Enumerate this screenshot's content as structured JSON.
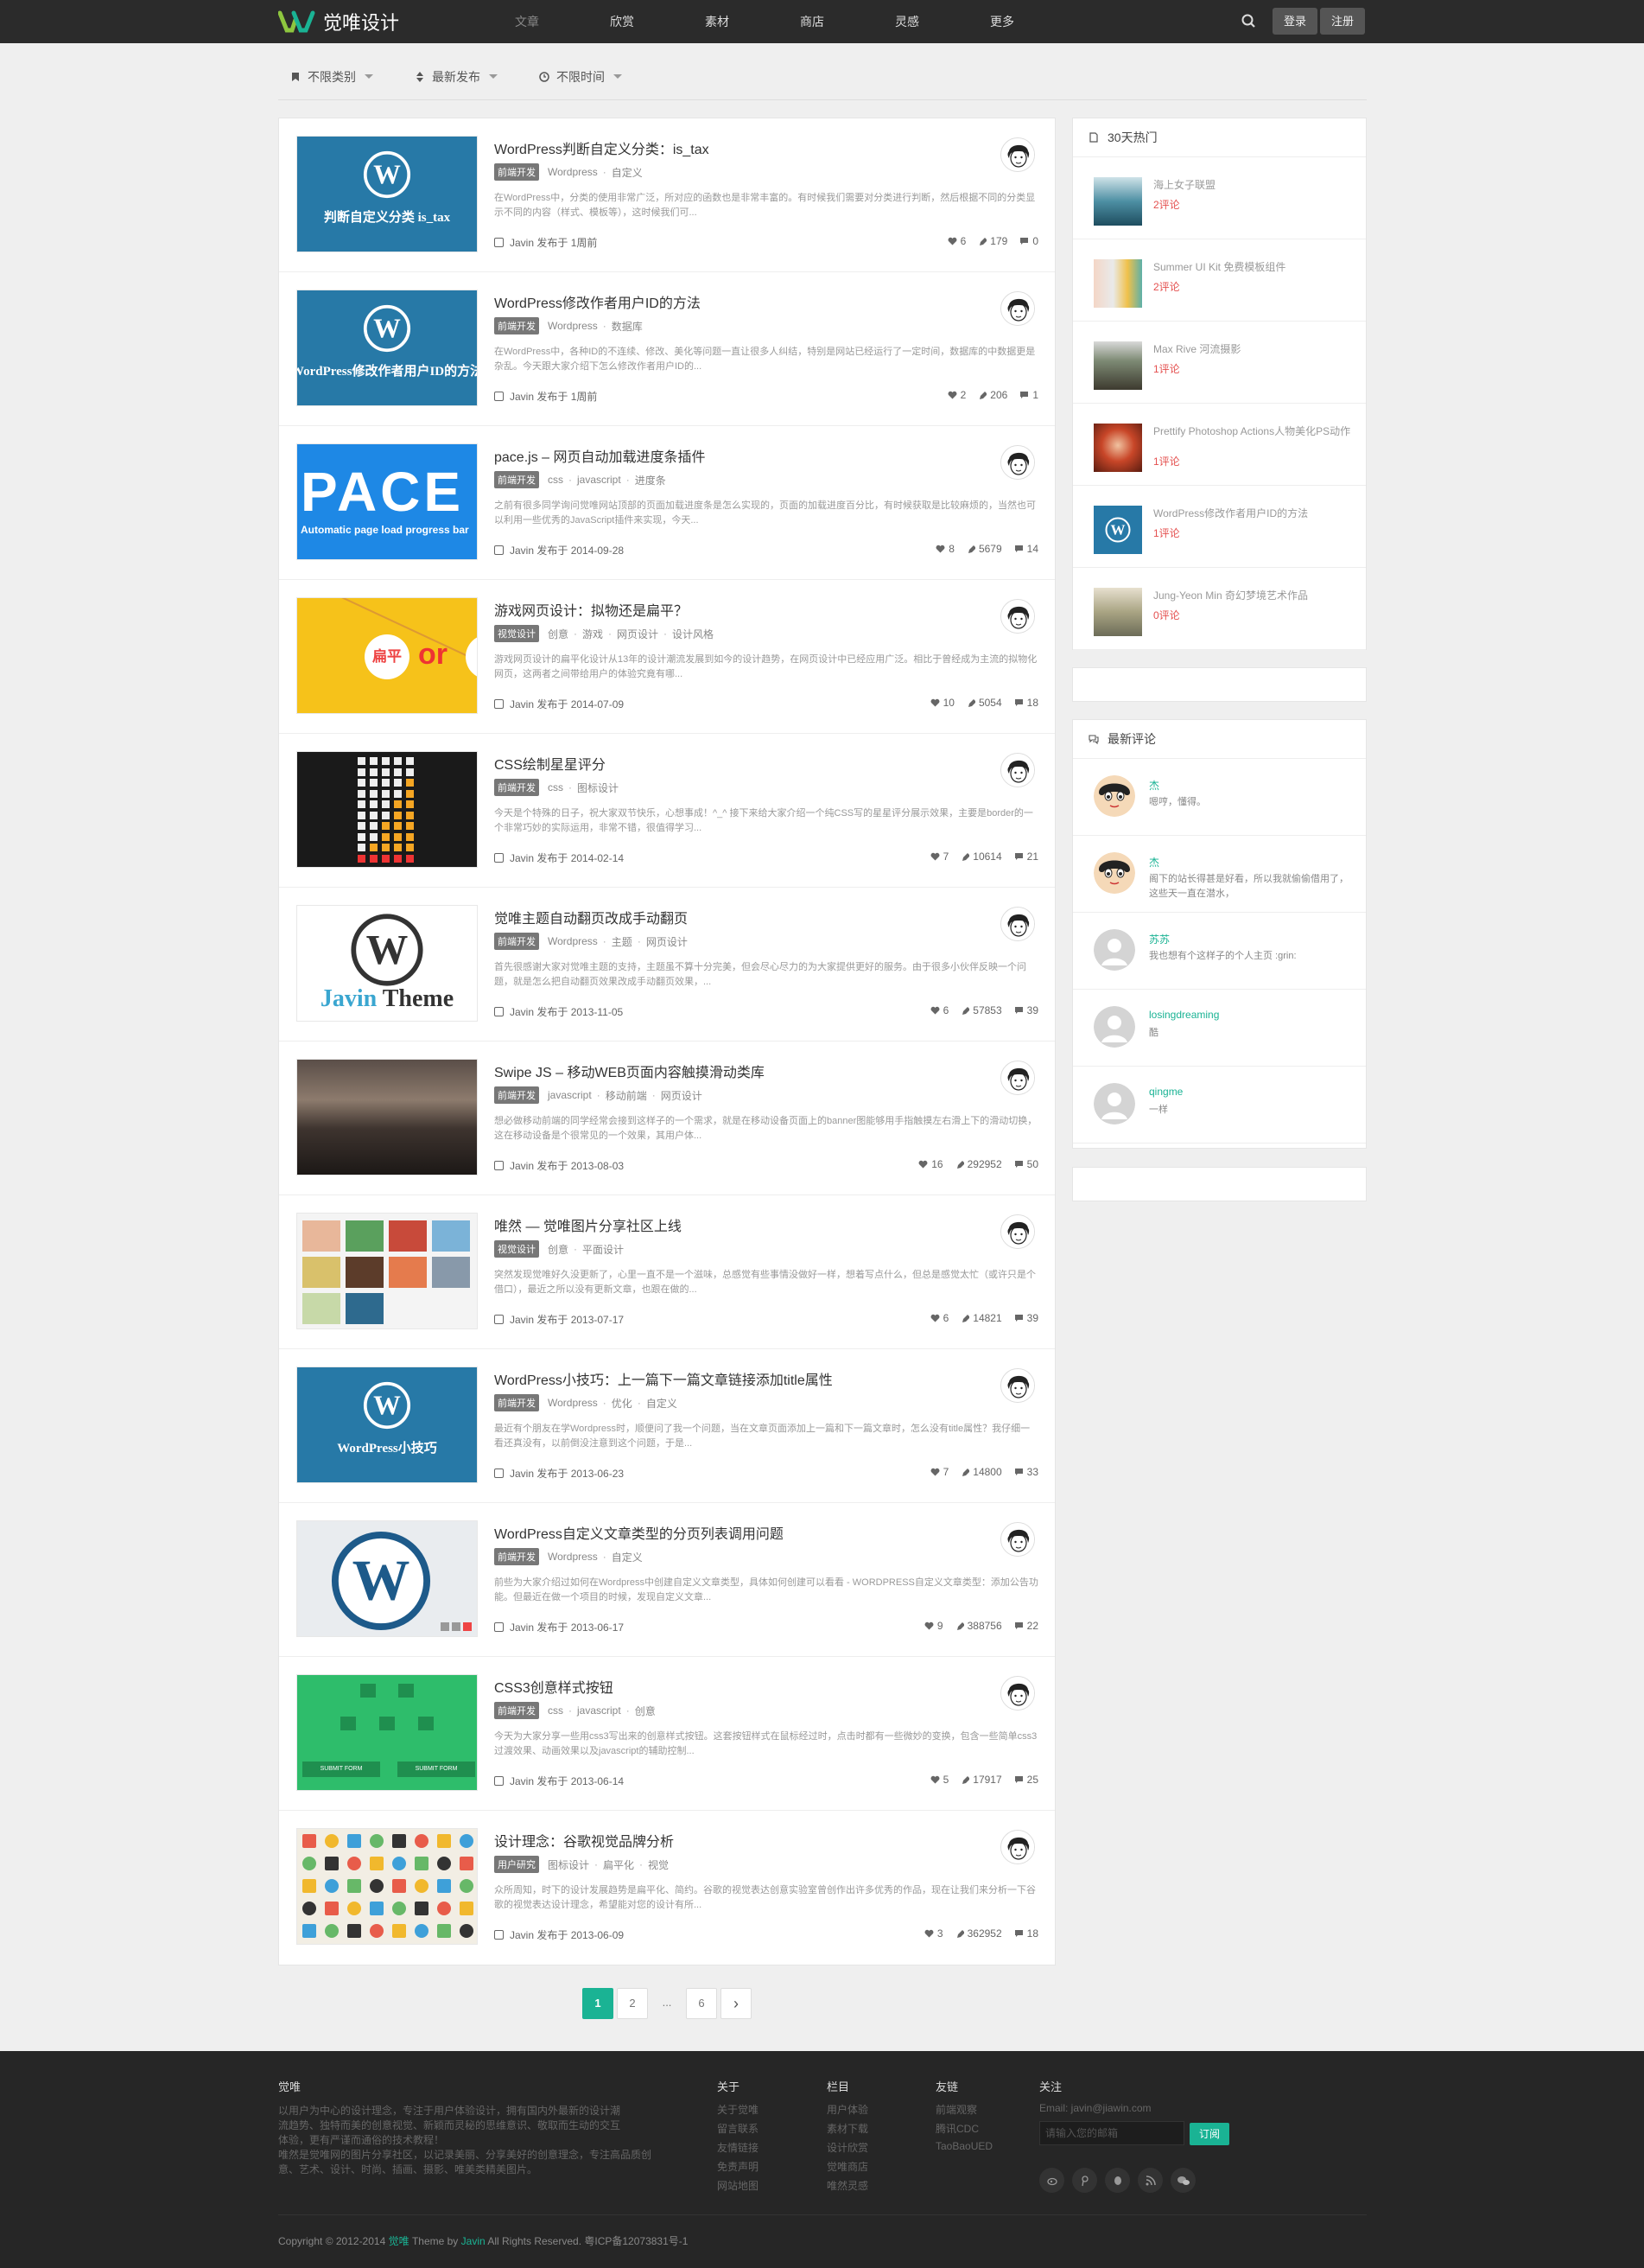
{
  "brand": {
    "name": "觉唯设计"
  },
  "nav": [
    "文章",
    "欣赏",
    "素材",
    "商店",
    "灵感",
    "更多"
  ],
  "auth": {
    "login": "登录",
    "register": "注册"
  },
  "filters": [
    "不限类别",
    "最新发布",
    "不限时间"
  ],
  "posts": [
    {
      "title": "WordPress判断自定义分类：is_tax",
      "badge": "前端开发",
      "tags": [
        "Wordpress",
        "自定义"
      ],
      "excerpt": "在WordPress中，分类的使用非常广泛，所对应的函数也是非常丰富的。有时候我们需要对分类进行判断，然后根据不同的分类显示不同的内容（样式、模板等），这时候我们可...",
      "author": "Javin",
      "date": "发布于 1周前",
      "likes": "6",
      "views": "179",
      "comments": "0",
      "thumb": "wp",
      "thumb_text": "判断自定义分类 is_tax"
    },
    {
      "title": "WordPress修改作者用户ID的方法",
      "badge": "前端开发",
      "tags": [
        "Wordpress",
        "数据库"
      ],
      "excerpt": "在WordPress中，各种ID的不连续、修改、美化等问题一直让很多人纠结，特别是网站已经运行了一定时间，数据库的中数据更是杂乱。今天跟大家介绍下怎么修改作者用户ID的...",
      "author": "Javin",
      "date": "发布于 1周前",
      "likes": "2",
      "views": "206",
      "comments": "1",
      "thumb": "wp",
      "thumb_text": "WordPress修改作者用户ID的方法"
    },
    {
      "title": "pace.js – 网页自动加载进度条插件",
      "badge": "前端开发",
      "tags": [
        "css",
        "javascript",
        "进度条"
      ],
      "excerpt": "之前有很多同学询问觉唯网站顶部的页面加载进度条是怎么实现的，页面的加载进度百分比，有时候获取是比较麻烦的，当然也可以利用一些优秀的JavaScript插件来实现，今天...",
      "author": "Javin",
      "date": "发布于 2014-09-28",
      "likes": "8",
      "views": "5679",
      "comments": "14",
      "thumb": "pace",
      "thumb_text": "PACE",
      "thumb_sub": "Automatic page load progress bar"
    },
    {
      "title": "游戏网页设计：拟物还是扁平？",
      "badge": "视觉设计",
      "tags": [
        "创意",
        "游戏",
        "网页设计",
        "设计风格"
      ],
      "excerpt": "游戏网页设计的扁平化设计从13年的设计潮流发展到如今的设计趋势，在网页设计中已经应用广泛。相比于曾经成为主流的拟物化网页，这两者之间带给用户的体验究竟有哪...",
      "author": "Javin",
      "date": "发布于 2014-07-09",
      "likes": "10",
      "views": "5054",
      "comments": "18",
      "thumb": "game",
      "thumb_text": "扁平",
      "thumb_or": "or"
    },
    {
      "title": "CSS绘制星星评分",
      "badge": "前端开发",
      "tags": [
        "css",
        "图标设计"
      ],
      "excerpt": "今天是个特殊的日子，祝大家双节快乐，心想事成！^_^ 接下来给大家介绍一个纯CSS写的星星评分展示效果，主要是border的一个非常巧妙的实际运用，非常不错，很值得学习...",
      "author": "Javin",
      "date": "发布于 2014-02-14",
      "likes": "7",
      "views": "10614",
      "comments": "21",
      "thumb": "stars"
    },
    {
      "title": "觉唯主题自动翻页改成手动翻页",
      "badge": "前端开发",
      "tags": [
        "Wordpress",
        "主题",
        "网页设计"
      ],
      "excerpt": "首先很感谢大家对觉唯主题的支持，主题虽不算十分完美，但会尽心尽力的为大家提供更好的服务。由于很多小伙伴反映一个问题，就是怎么把自动翻页效果改成手动翻页效果，...",
      "author": "Javin",
      "date": "发布于 2013-11-05",
      "likes": "6",
      "views": "57853",
      "comments": "39",
      "thumb": "theme",
      "thumb_text": "Javin Theme"
    },
    {
      "title": "Swipe JS – 移动WEB页面内容触摸滑动类库",
      "badge": "前端开发",
      "tags": [
        "javascript",
        "移动前端",
        "网页设计"
      ],
      "excerpt": "想必做移动前端的同学经常会接到这样子的一个需求，就是在移动设备页面上的banner图能够用手指触摸左右滑上下的滑动切换，这在移动设备是个很常见的一个效果，其用户体...",
      "author": "Javin",
      "date": "发布于 2013-08-03",
      "likes": "16",
      "views": "292952",
      "comments": "50",
      "thumb": "sky"
    },
    {
      "title": "唯然 — 觉唯图片分享社区上线",
      "badge": "视觉设计",
      "tags": [
        "创意",
        "平面设计"
      ],
      "excerpt": "突然发现觉唯好久没更新了，心里一直不是一个滋味，总感觉有些事情没做好一样，想着写点什么，但总是感觉太忙（或许只是个借口），最近之所以没有更新文章，也跟在做的...",
      "author": "Javin",
      "date": "发布于 2013-07-17",
      "likes": "6",
      "views": "14821",
      "comments": "39",
      "thumb": "grid"
    },
    {
      "title": "WordPress小技巧：上一篇下一篇文章链接添加title属性",
      "badge": "前端开发",
      "tags": [
        "Wordpress",
        "优化",
        "自定义"
      ],
      "excerpt": "最近有个朋友在学Wordpress时，顺便问了我一个问题，当在文章页面添加上一篇和下一篇文章时，怎么没有title属性？我仔细一看还真没有，以前倒没注意到这个问题，于是...",
      "author": "Javin",
      "date": "发布于 2013-06-23",
      "likes": "7",
      "views": "14800",
      "comments": "33",
      "thumb": "wp",
      "thumb_text": "WordPress小技巧"
    },
    {
      "title": "WordPress自定义文章类型的分页列表调用问题",
      "badge": "前端开发",
      "tags": [
        "Wordpress",
        "自定义"
      ],
      "excerpt": "前些为大家介绍过如何在Wordpress中创建自定义文章类型，具体如何创建可以看看 - WORDPRESS自定义文章类型：添加公告功能。但最近在做一个项目的时候，发现自定义文章...",
      "author": "Javin",
      "date": "发布于 2013-06-17",
      "likes": "9",
      "views": "388756",
      "comments": "22",
      "thumb": "wpbig"
    },
    {
      "title": "CSS3创意样式按钮",
      "badge": "前端开发",
      "tags": [
        "css",
        "javascript",
        "创意"
      ],
      "excerpt": "今天为大家分享一些用css3写出来的创意样式按钮。这套按钮样式在鼠标经过时，点击时都有一些微妙的变换，包含一些简单css3过渡效果、动画效果以及javascript的辅助控制...",
      "author": "Javin",
      "date": "发布于 2013-06-14",
      "likes": "5",
      "views": "17917",
      "comments": "25",
      "thumb": "green",
      "thumb_btn": "SUBMIT FORM"
    },
    {
      "title": "设计理念：谷歌视觉品牌分析",
      "badge": "用户研究",
      "tags": [
        "图标设计",
        "扁平化",
        "视觉"
      ],
      "excerpt": "众所周知，时下的设计发展趋势是扁平化、简约。谷歌的视觉表达创意实验室曾创作出许多优秀的作品，现在让我们来分析一下谷歌的视觉表达设计理念，希望能对您的设计有所...",
      "author": "Javin",
      "date": "发布于 2013-06-09",
      "likes": "3",
      "views": "362952",
      "comments": "18",
      "thumb": "pattern"
    }
  ],
  "sidebar": {
    "hot_title": "30天热门",
    "hot": [
      {
        "title": "海上女子联盟",
        "count": "2评论",
        "img": "sea"
      },
      {
        "title": "Summer UI Kit 免费模板组件",
        "count": "2评论",
        "img": "ui"
      },
      {
        "title": "Max Rive 河流摄影",
        "count": "1评论",
        "img": "river"
      },
      {
        "title": "Prettify Photoshop Actions人物美化PS动作",
        "count": "1评论",
        "img": "red"
      },
      {
        "title": "WordPress修改作者用户ID的方法",
        "count": "1评论",
        "img": "wp"
      },
      {
        "title": "Jung-Yeon Min 奇幻梦境艺术作品",
        "count": "0评论",
        "img": "art"
      }
    ],
    "comments_title": "最新评论",
    "comments": [
      {
        "name": "杰",
        "text": "嗯哼，懂得。",
        "avatar": "cartoon"
      },
      {
        "name": "杰",
        "text": "阁下的站长得甚是好看，所以我就偷偷借用了，这些天一直在潜水，",
        "avatar": "cartoon"
      },
      {
        "name": "苏苏",
        "text": "我也想有个这样子的个人主页 :grin:",
        "avatar": "default"
      },
      {
        "name": "losingdreaming",
        "text": "酷",
        "avatar": "default"
      },
      {
        "name": "qingme",
        "text": "一样",
        "avatar": "default"
      }
    ]
  },
  "pagination": {
    "pages": [
      "1",
      "2",
      "...",
      "6"
    ],
    "next": "›"
  },
  "footer": {
    "about_title": "觉唯",
    "about_text": [
      "以用户为中心的设计理念，专注于用户体验设计，拥有国内外最新的设计潮",
      "流趋势、独特而美的创意视觉、新颖而灵秘的思维意识、敬取而生动的交互",
      "体验，更有严谨而通俗的技术教程！",
      "唯然是觉唯网的图片分享社区，以记录美丽、分享美好的创意理念，专注高品质创",
      "意、艺术、设计、时尚、插画、摄影、唯美类精美图片。"
    ],
    "cols": [
      {
        "title": "关于",
        "links": [
          "关于觉唯",
          "留言联系",
          "友情链接",
          "免责声明",
          "网站地图"
        ]
      },
      {
        "title": "栏目",
        "links": [
          "用户体验",
          "素材下载",
          "设计欣赏",
          "觉唯商店",
          "唯然灵感"
        ]
      },
      {
        "title": "友链",
        "links": [
          "前端观察",
          "腾讯CDC",
          "TaoBaoUED"
        ]
      }
    ],
    "follow_title": "关注",
    "email": "Email: javin@jiawin.com",
    "email_placeholder": "请输入您的邮箱",
    "subscribe": "订阅",
    "copyright_pre": "Copyright © 2012-2014 ",
    "copyright_brand": "觉唯",
    "copyright_mid": " Theme by ",
    "copyright_author": "Javin",
    "copyright_post": " All Rights Reserved. 粤ICP备12073831号-1"
  },
  "colors": {
    "accent": "#1ab394",
    "topbar": "#2b2b2b",
    "footer": "#262626",
    "hot_count": "#e4504f",
    "wp_blue": "#2779a7"
  }
}
